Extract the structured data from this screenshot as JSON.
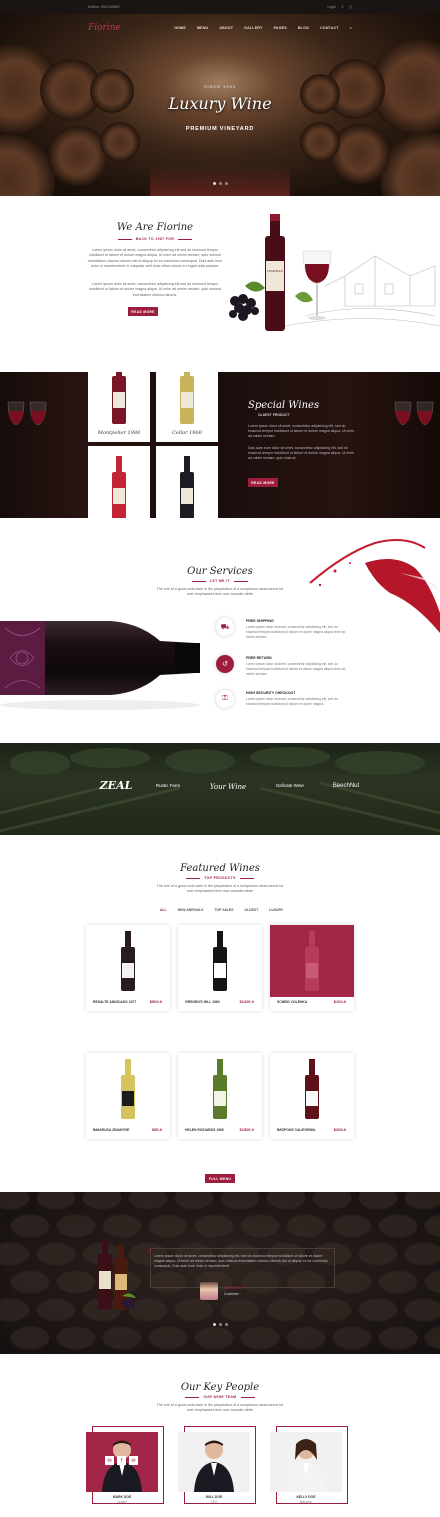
{
  "topbar": {
    "phone": "Hotline: 0912345567",
    "login": "Login",
    "search_icon": "search-icon",
    "cart_icon": "cart-icon"
  },
  "nav": {
    "logo": "Fiorine",
    "menu": [
      "HOME",
      "MENU",
      "ABOUT",
      "GALLERY",
      "PAGES",
      "BLOG",
      "CONTACT"
    ]
  },
  "hero": {
    "since": "SINCE 1994",
    "title": "Luxury Wine",
    "subtitle": "PREMIUM VINEYARD",
    "slide": 1,
    "slides": 3
  },
  "about": {
    "title": "We Are Fiorine",
    "subtitle": "BACK TO 1987 FOR",
    "p1": "Lorem ipsum dolor sit amet, consectetur adipisicing elit sed do eiusmod tempor incididunt ut labore et dolore magna aliqua. Ut enim ad minim veniam, quis nostrud exercitation ullamco laboris nisi ut aliquip ex ea commodo consequat. Duis aute irure dolor in reprehenderit in voluptate velit esse cillum dolore eu fugiat nulla pariatur.",
    "p2": "Lorem ipsum dolor sit amet, consectetur adipisicing elit sed do eiusmod tempor incididunt ut labore et dolore magna aliqua. Ut enim ad minim veniam, quis nostrud exercitation ullamco laboris.",
    "button": "READ MORE"
  },
  "special": {
    "title": "Special Wines",
    "subtitle": "OLDEST PRODUCT",
    "p1": "Lorem ipsum dolor sit amet, consectetur adipisicing elit, sed do eiusmod tempor incididunt ut labore et dolore magna aliqua. Ut enim ad minim veniam.",
    "p2": "Duis aute irure dolor sit amet, consectetur adipisicing elit, sed do eiusmod tempor incididunt ut labore et dolore magna aliqua. Ut enim ad minim veniam, quis nostrud.",
    "button": "READ MORE",
    "price_tag": "$300.0",
    "wines": [
      {
        "name": "Montpelier 1988",
        "color": "#7a1426"
      },
      {
        "name": "Cellar 1960",
        "color": "#c9b45a"
      },
      {
        "name": "Chardonay 2011",
        "color": "#c22434"
      },
      {
        "name": "Agaveta Reserva 1970",
        "color": "#1c1c24"
      }
    ]
  },
  "services": {
    "title": "Our Services",
    "subtitle": "LET ME IT",
    "intro": "The role of a good cook ware in the preparation of a sumptuous meal cannot be over emphasized then one consider white",
    "items": [
      {
        "icon": "truck-icon",
        "title": "FREE SHIPPING",
        "desc": "Lorem ipsum dolor sit amet, consectetur adipisicing elit, sed do eiusmod tempor incididunt ut labore et dolore magna aliqua enim ad minim veniam."
      },
      {
        "icon": "return-icon",
        "title": "FREE RETURN",
        "desc": "Lorem ipsum dolor sit amet, consectetur adipisicing elit, sed do eiusmod tempor incididunt ut labore et dolore magna aliqua enim ad minim veniam."
      },
      {
        "icon": "lock-icon",
        "title": "HIGH SECURITY CHECKOUT",
        "desc": "Lorem ipsum dolor sit amet, consectetur adipisicing elit, sed do eiusmod tempor incididunt ut labore et dolore magna."
      }
    ]
  },
  "brands": [
    "ZEAL",
    "Rustic Farm",
    "Your Wine",
    "Delicate Wine",
    "BeechNut"
  ],
  "featured": {
    "title": "Featured Wines",
    "subtitle": "TOP PRODUCTS",
    "intro": "The role of a good cook ware in the preparation of a sumptuous meal cannot be over emphasized then one consider white",
    "tabs": [
      "ALL",
      "NEW ARRIVALS",
      "TOP SALES",
      "OLDEST",
      "LUXURY"
    ],
    "products": [
      {
        "name": "RESALTE ANNICADO 1977",
        "price": "$500.0",
        "bottle": "#2a1a22",
        "label": "#f2f2f2",
        "bg": "#ffffff"
      },
      {
        "name": "GREGEN'S HILL 1960",
        "price": "$1200.0",
        "bottle": "#151515",
        "label": "#ffffff",
        "bg": "#ffffff"
      },
      {
        "name": "SCHEID VOLENKA",
        "price": "$100.0",
        "bottle": "#b73c5a",
        "label": "#c85a75",
        "bg": "#a32547"
      },
      {
        "name": "BIMARUSA ZINANTHE",
        "price": "$50.0",
        "bottle": "#d6c35e",
        "label": "#1b1b1b",
        "bg": "#ffffff"
      },
      {
        "name": "HELEN RICHARDS 1960",
        "price": "$1500.0",
        "bottle": "#5a7a2c",
        "label": "#f4f4e6",
        "bg": "#ffffff"
      },
      {
        "name": "BESPOKE CALIFORNIA",
        "price": "$200.0",
        "bottle": "#5c1218",
        "label": "#fafafa",
        "bg": "#ffffff"
      }
    ],
    "button": "FULL MENU"
  },
  "testimonial": {
    "quote": "Lorem ipsum dolor sit amet, consectetur adipisicing elit, sed do eiusmod tempor incididunt ut labore et dolore magna aliqua. Ut enim ad minim veniam, quis nostrud exercitation ullamco laboris nisi ut aliquip ex ea commodo consequat. Duis aute irure dolor in reprehenderit.",
    "name": "JOHN DOE",
    "role": "Customer"
  },
  "team": {
    "title": "Our Key People",
    "subtitle": "OUR WINE TEAM",
    "intro": "The role of a good cook ware in the preparation of a sumptuous meal cannot be over emphasized then one consider white",
    "members": [
      {
        "name": "MARK DOE",
        "role": "Leader",
        "highlight": true
      },
      {
        "name": "WILL DOE",
        "role": "CEO",
        "highlight": false
      },
      {
        "name": "KELLY DOE",
        "role": "Manager",
        "highlight": false
      }
    ]
  },
  "colors": {
    "accent": "#9c1e3d",
    "dark": "#1a1412"
  }
}
